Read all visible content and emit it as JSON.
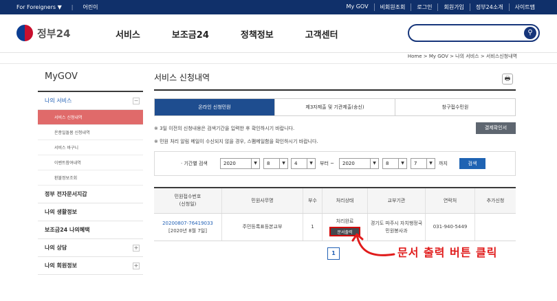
{
  "topbar": {
    "lang": "For Foreigners",
    "lang_caret": "▼",
    "easy": "어린이",
    "links": [
      "My GOV",
      "비회원조회",
      "로그인",
      "회원가입",
      "정부24소개",
      "사이트맵"
    ]
  },
  "header": {
    "logo_text": "정부24",
    "nav": [
      "서비스",
      "보조금24",
      "정책정보",
      "고객센터"
    ],
    "search_placeholder": "",
    "search_icon": "⚲"
  },
  "breadcrumb": "Home  >  My GOV  >  나의 서비스  >  서비스신청내역",
  "sidebar": {
    "title": "MyGOV",
    "menus": [
      {
        "label": "나의 서비스",
        "toggle": "−",
        "active": true
      },
      {
        "label": "정부 전자문서지갑",
        "toggle": ""
      },
      {
        "label": "나의 생활정보",
        "toggle": ""
      },
      {
        "label": "보조금24 나의혜택",
        "toggle": ""
      },
      {
        "label": "나의 상담",
        "toggle": "+"
      },
      {
        "label": "나의 회원정보",
        "toggle": "+"
      }
    ],
    "subs": [
      "서비스 신청내역",
      "온종일돌봄 신청내역",
      "서비스 바구니",
      "이벤트참여내역",
      "환불정보조회"
    ]
  },
  "main": {
    "title": "서비스 신청내역",
    "print_icon": "🖶",
    "tabs": [
      "온라인 신청민원",
      "제3자제출 및 기관제출(송신)",
      "창구접수민원"
    ],
    "notes": [
      "※ 3일 이전의 신청내용은 검색기간을 입력한 후 확인하시기 바랍니다.",
      "※ 민원 처리 알림 메일이 수신되지 않을 경우, 스팸메일함을 확인하시기 바랍니다."
    ],
    "pay_button": "결제확인서",
    "filter": {
      "label": "· 기간별 검색",
      "from_year": "2020",
      "from_month": "8",
      "from_day": "4",
      "from_text": "부터 ~",
      "to_year": "2020",
      "to_month": "8",
      "to_day": "7",
      "to_text": "까지",
      "search_button": "검색",
      "arrow": "▼"
    },
    "table": {
      "headers": [
        "민원접수번호\n(신청일)",
        "민원사무명",
        "부수",
        "처리상태",
        "교부기관",
        "연락처",
        "추가신청"
      ],
      "row": {
        "receipt_no": "20200807-76419033",
        "date": "[2020년 8월 7일]",
        "name": "주민등록표등본교부",
        "copies": "1",
        "status": "처리완료",
        "output_button": "문서출력",
        "agency": "경기도 파주시 자치행정국",
        "agency2": "민원봉사과",
        "contact": "031-940-5449",
        "extra": ""
      }
    },
    "page": "1"
  },
  "annotation": "문서 출력 버튼 클릭"
}
